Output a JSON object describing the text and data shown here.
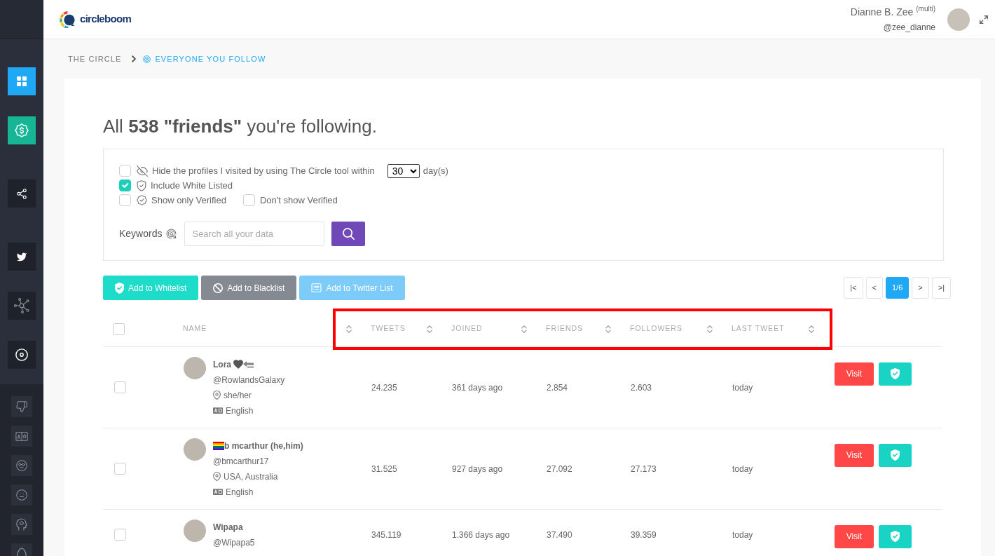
{
  "sidebar": {
    "items": [
      {
        "color": "#1fa8f4"
      },
      {
        "color": "#15b595"
      },
      {
        "color": "#1f222b"
      },
      {
        "color": "#1f222b"
      },
      {
        "color": "#1f222b"
      },
      {
        "color": "#1f222b"
      }
    ]
  },
  "topbar": {
    "logo": "circleboom",
    "user_name": "Dianne B. Zee $^{(multi)}$",
    "user_handle": "@zee_dianne"
  },
  "breadcrumb": [
    {
      "label": "THE CIRCLE",
      "current": false
    },
    {
      "label": "EVERYONE YOU FOLLOW",
      "current": true
    }
  ],
  "heading": "All **538 \"friends\"** you're following.",
  "filters": {
    "rows": [
      [
        {
          "label": "Hide the profiles I visited by using The Circle tool within",
          "checked": false,
          "days": {
            "value": "30",
            "unit": "day(s)"
          }
        }
      ],
      [
        {
          "label": "Include White Listed",
          "checked": true
        }
      ],
      [
        {
          "label": "Show only Verified",
          "checked": false
        },
        {
          "label": "Don't show Verified",
          "checked": false
        }
      ]
    ],
    "keywords": {
      "label": "Keywords",
      "placeholder": "Search all your data"
    }
  },
  "actions": [
    {
      "label": "Add to Whitelist",
      "color": "#1ddcca"
    },
    {
      "label": "Add to Blacklist",
      "color": "#858a92"
    },
    {
      "label": "Add to Twitter List",
      "color": "#7ccbf8"
    }
  ],
  "pagination": [
    {
      "label": "|<",
      "selected": false
    },
    {
      "label": "<",
      "selected": false
    },
    {
      "label": "1/6",
      "selected": true
    },
    {
      "label": ">",
      "selected": false
    },
    {
      "label": ">|",
      "selected": false
    }
  ],
  "table": {
    "highlighted_header": true,
    "select_all": {
      "checked": false
    },
    "columns": [
      "NAME",
      "TWEETS",
      "JOINED",
      "FRIENDS",
      "FOLLOWERS",
      "LAST TWEET"
    ],
    "rows": [
      {
        "checked": false,
        "name": "Lora",
        "emoji_after": [
          {
            "kind": "heart"
          },
          {
            "kind": "back-arrow"
          }
        ],
        "handle": "@RowlandsGalaxy",
        "location": "she/her",
        "language": "English",
        "tweets": "24.235",
        "joined": "361 days ago",
        "friends": "2.854",
        "followers": "2.603",
        "last_tweet": "today",
        "visit": "Visit"
      },
      {
        "checked": false,
        "name": "b mcarthur (he,him)",
        "emoji_before": [
          {
            "kind": "rainbow-flag"
          }
        ],
        "handle": "@bmcarthur17",
        "location": "USA, Australia",
        "language": "English",
        "tweets": "31.525",
        "joined": "927 days ago",
        "friends": "27.092",
        "followers": "27.173",
        "last_tweet": "today",
        "visit": "Visit"
      },
      {
        "checked": false,
        "name": "Wipapa",
        "handle": "@Wipapa5",
        "tweets": "345.119",
        "joined": "1.366 days ago",
        "friends": "37.490",
        "followers": "39.359",
        "last_tweet": "today",
        "visit": "Visit"
      }
    ]
  }
}
